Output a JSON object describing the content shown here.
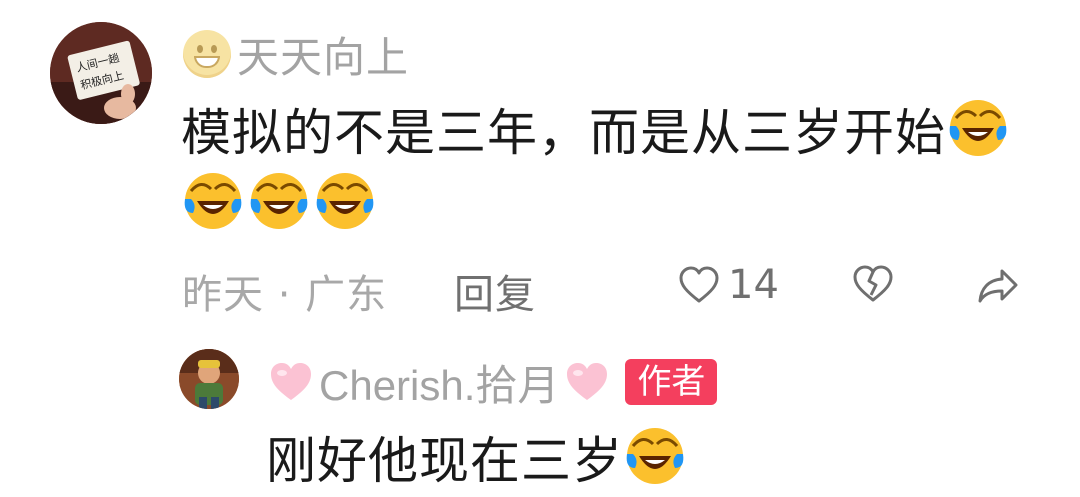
{
  "comment": {
    "username": "天天向上",
    "text": "模拟的不是三年，而是从三岁开始",
    "laugh_emoji": "laughing-crying-emoji",
    "time": "昨天",
    "separator": "·",
    "location": "广东",
    "reply_label": "回复",
    "like_count": "14"
  },
  "reply": {
    "username": "Cherish.拾月",
    "author_badge": "作者",
    "text": "刚好他现在三岁"
  },
  "colors": {
    "text_primary": "#1a1a1a",
    "text_secondary": "#a3a3a3",
    "badge_red": "#f43f5e",
    "heart_pink": "#f9b6c8"
  }
}
